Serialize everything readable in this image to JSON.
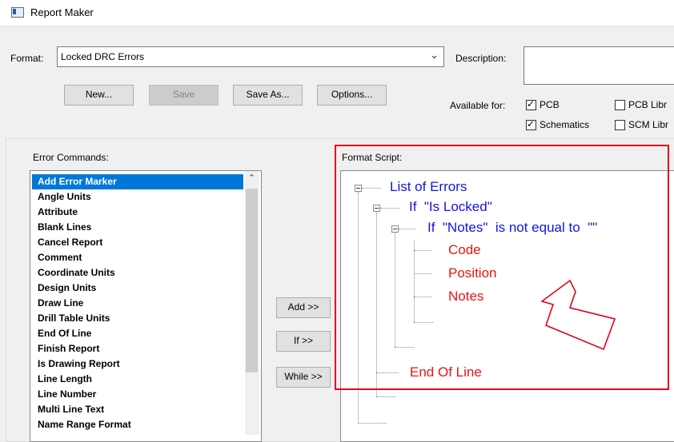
{
  "window": {
    "title": "Report Maker"
  },
  "format": {
    "label": "Format:",
    "value": "Locked DRC Errors",
    "description_label": "Description:"
  },
  "buttons": {
    "new": "New...",
    "save": "Save",
    "save_as": "Save As...",
    "options": "Options..."
  },
  "available_for": {
    "label": "Available for:",
    "options": [
      {
        "label": "PCB",
        "checked": true
      },
      {
        "label": "PCB Libr",
        "checked": false
      },
      {
        "label": "Schematics",
        "checked": true
      },
      {
        "label": "SCM Libr",
        "checked": false
      }
    ]
  },
  "error_commands": {
    "label": "Error Commands:",
    "items": [
      "Add Error Marker",
      "Angle Units",
      "Attribute",
      "Blank Lines",
      "Cancel Report",
      "Comment",
      "Coordinate Units",
      "Design Units",
      "Draw Line",
      "Drill Table Units",
      "End Of Line",
      "Finish Report",
      "Is Drawing Report",
      "Line Length",
      "Line Number",
      "Multi Line Text",
      "Name Range Format"
    ],
    "selected_index": 0
  },
  "middle_buttons": {
    "add": "Add >>",
    "if": "If >>",
    "while": "While >>"
  },
  "format_script": {
    "label": "Format Script:",
    "nodes": [
      "List of Errors",
      "If  \"Is Locked\"",
      "If  \"Notes\"  is not equal to  \"\"",
      "Code",
      "Position",
      "Notes",
      "End Of Line"
    ]
  },
  "colors": {
    "highlight": "#e3001b",
    "selection": "#0078d7",
    "keyword": "#1313e8",
    "field": "#ee1111"
  }
}
